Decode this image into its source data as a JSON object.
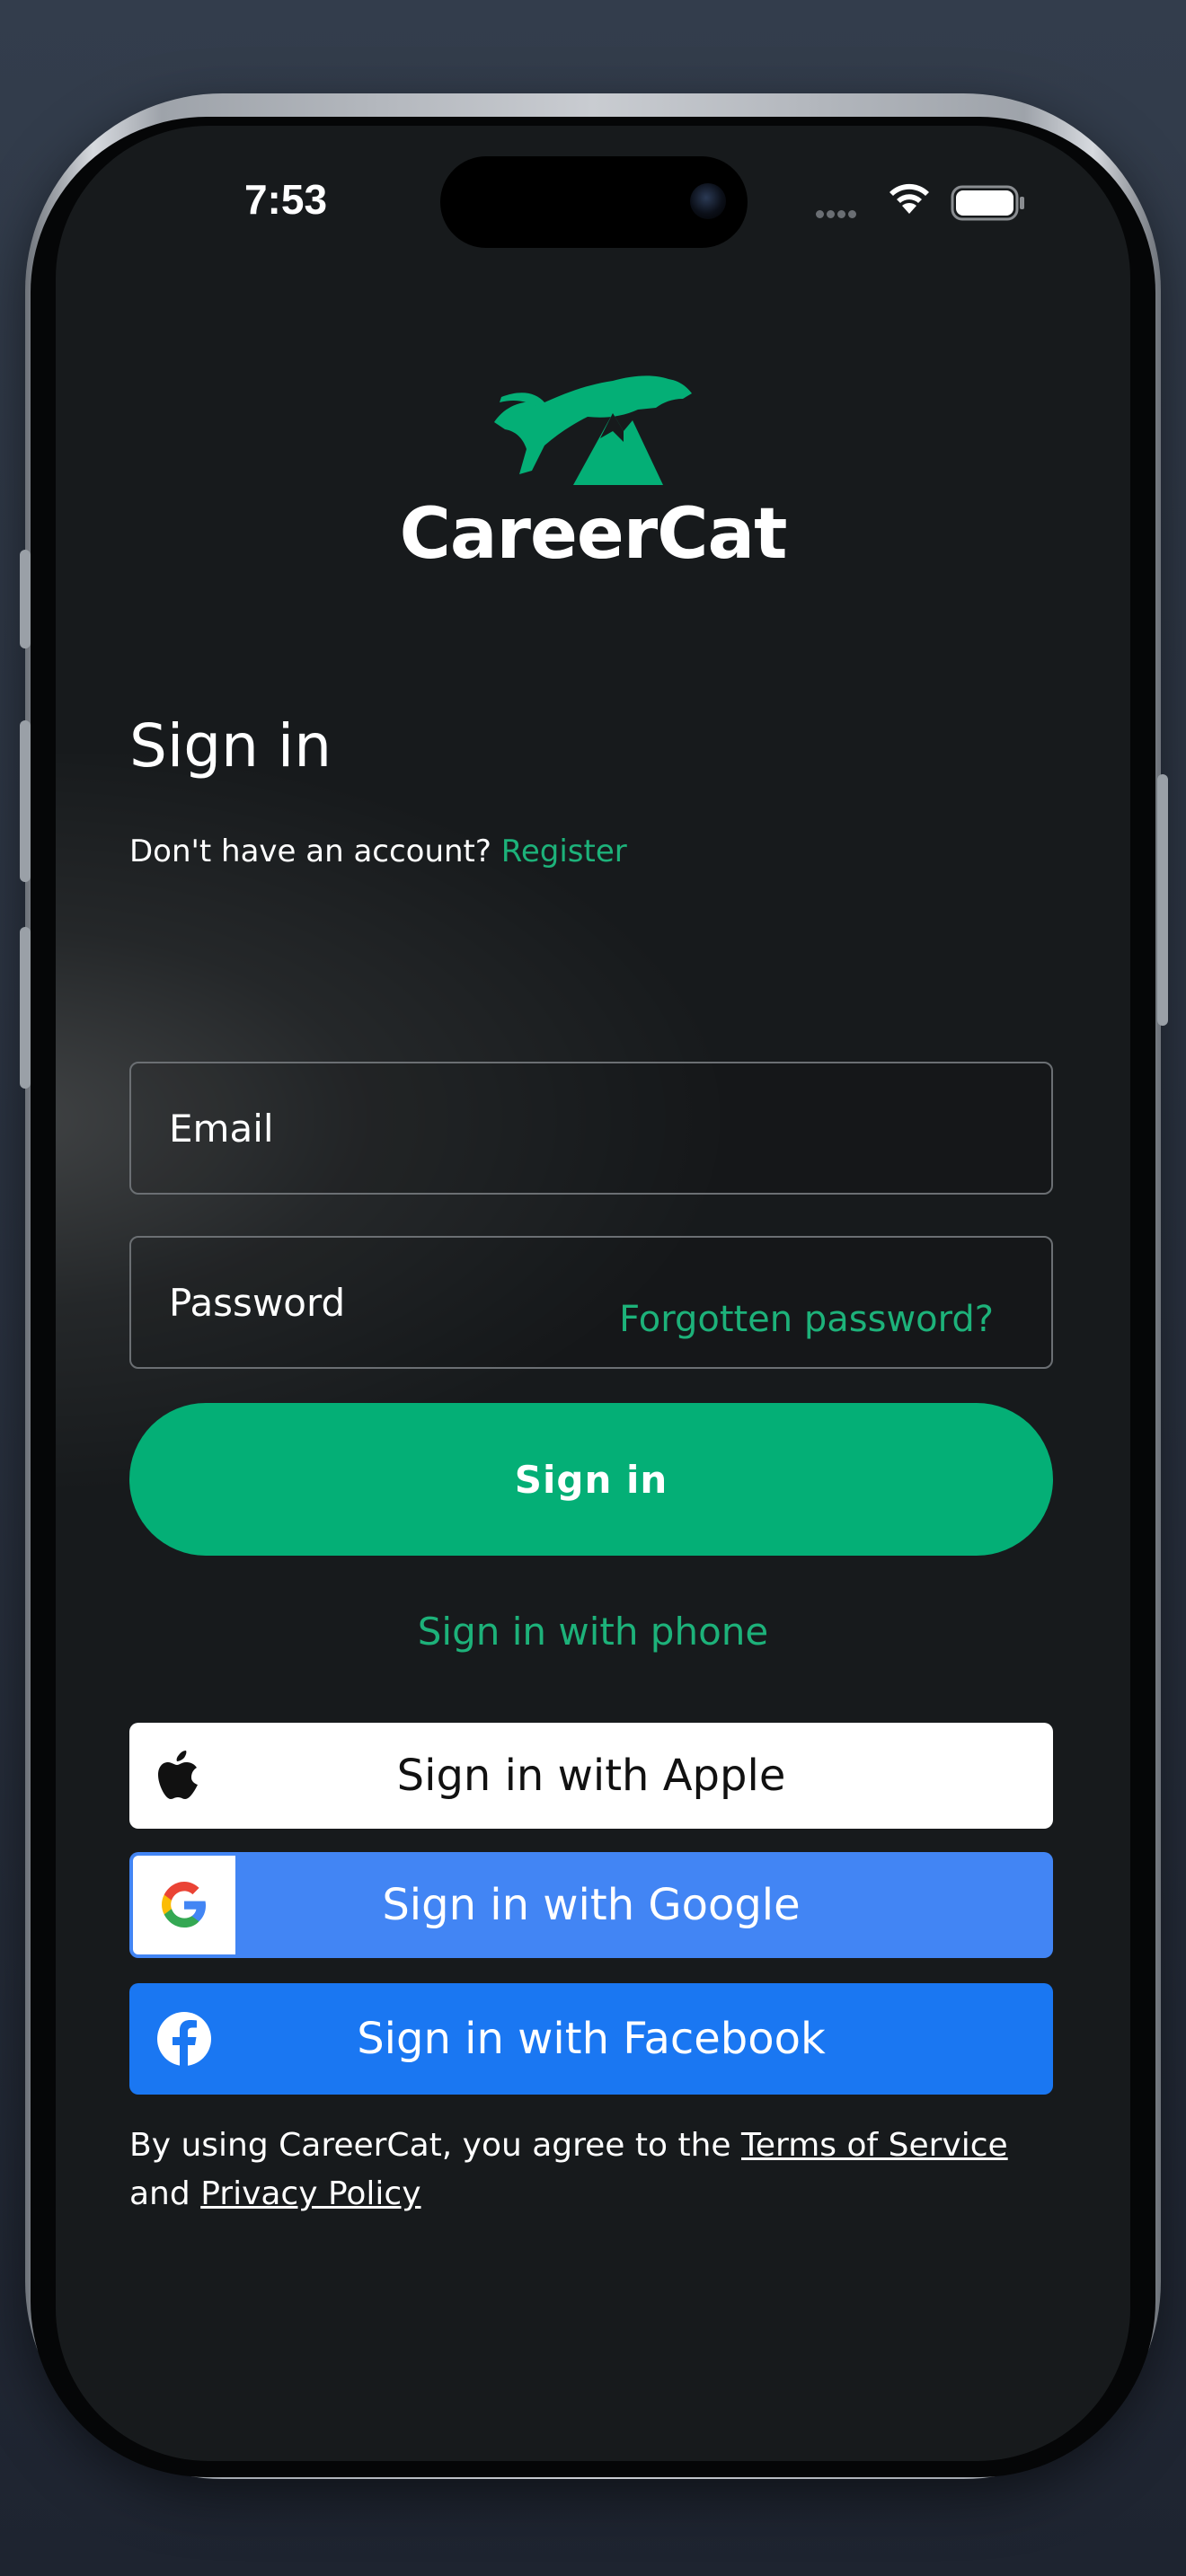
{
  "status_bar": {
    "time": "7:53"
  },
  "brand": {
    "name": "CareerCat",
    "accent_color": "#04af76",
    "logo_icon": "leaping-cat-mountain-logo"
  },
  "signin": {
    "heading": "Sign in",
    "register_prompt": "Don't have an account?",
    "register_link": "Register",
    "email_placeholder": "Email",
    "password_placeholder": "Password",
    "forgot_link": "Forgotten password?",
    "submit_label": "Sign in",
    "phone_link": "Sign in with phone"
  },
  "social": {
    "apple_label": "Sign in with Apple",
    "google_label": "Sign in with Google",
    "facebook_label": "Sign in with Facebook",
    "apple_icon": "apple-icon",
    "google_icon": "google-icon",
    "facebook_icon": "facebook-icon",
    "google_color": "#4285f4",
    "facebook_color": "#1a77f2"
  },
  "legal": {
    "prefix": "By using CareerCat, you agree to the",
    "terms_link": "Terms of Service",
    "and_text": "and",
    "privacy_link": "Privacy Policy"
  }
}
